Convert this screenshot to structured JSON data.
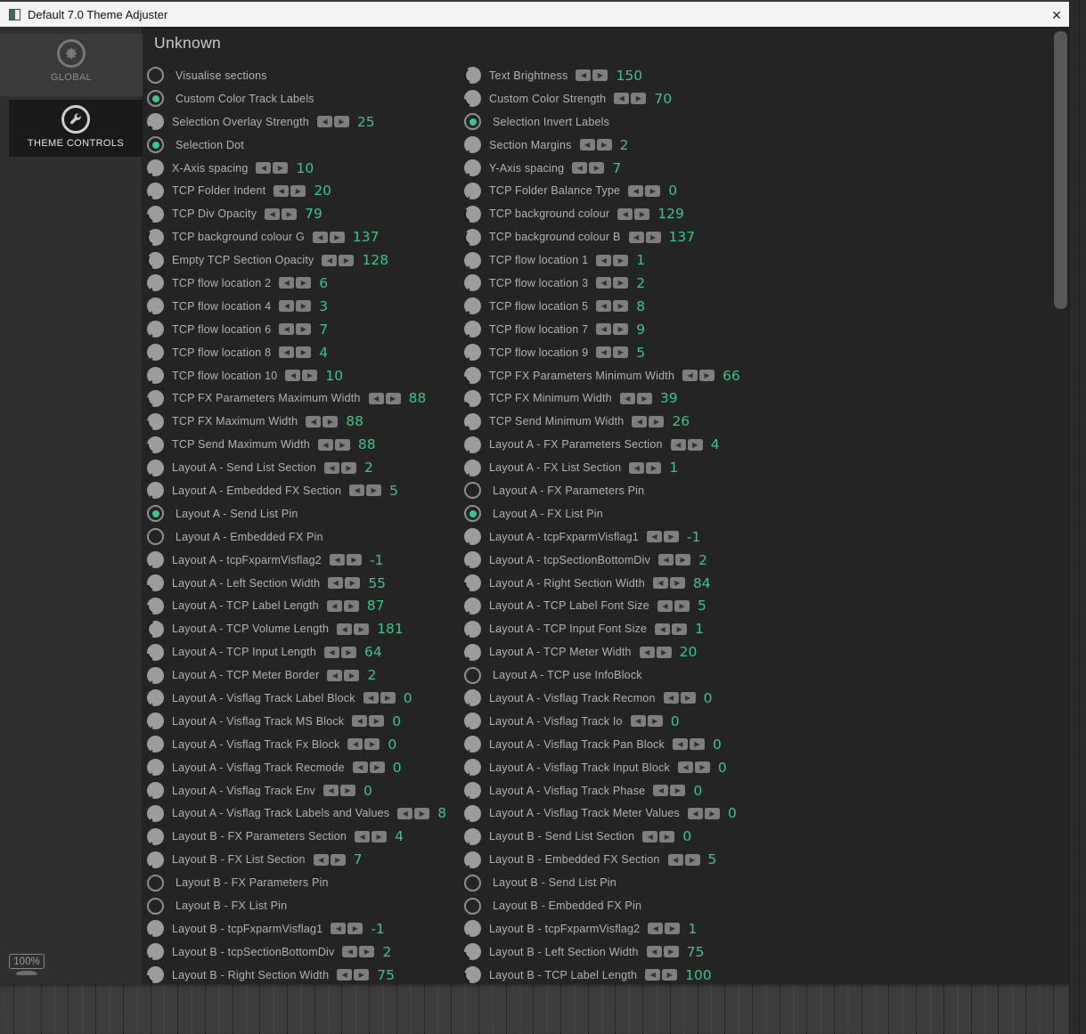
{
  "window": {
    "title": "Default 7.0 Theme Adjuster",
    "close_label": "✕"
  },
  "sidebar": {
    "tabs": [
      {
        "label": "GLOBAL",
        "icon": "gear-icon",
        "active": false
      },
      {
        "label": "THEME CONTROLS",
        "icon": "wrench-icon",
        "active": true
      }
    ],
    "zoom_badge": "100%"
  },
  "content": {
    "heading": "Unknown"
  },
  "icons": {
    "step_down": "◀",
    "step_up": "▶"
  },
  "colors": {
    "accent_green": "#3cc48c",
    "toggle_green": "#2fae78",
    "knob_gray": "#9c9c9c"
  },
  "controls": {
    "left": [
      {
        "label": "Visualise sections",
        "type": "toggle",
        "on": false
      },
      {
        "label": "Custom Color Track Labels",
        "type": "toggle",
        "on": true
      },
      {
        "label": "Selection Overlay Strength",
        "type": "knob",
        "value": "25"
      },
      {
        "label": "Selection Dot",
        "type": "toggle",
        "on": true
      },
      {
        "label": "X-Axis spacing",
        "type": "knob",
        "value": "10"
      },
      {
        "label": "TCP Folder Indent",
        "type": "knob",
        "value": "20"
      },
      {
        "label": "TCP Div Opacity",
        "type": "knob",
        "value": "79"
      },
      {
        "label": "TCP background colour G",
        "type": "knob",
        "value": "137"
      },
      {
        "label": "Empty TCP Section Opacity",
        "type": "knob",
        "value": "128"
      },
      {
        "label": "TCP flow location 2",
        "type": "knob",
        "value": "6"
      },
      {
        "label": "TCP flow location 4",
        "type": "knob",
        "value": "3"
      },
      {
        "label": "TCP flow location 6",
        "type": "knob",
        "value": "7"
      },
      {
        "label": "TCP flow location 8",
        "type": "knob",
        "value": "4"
      },
      {
        "label": "TCP flow location 10",
        "type": "knob",
        "value": "10"
      },
      {
        "label": "TCP FX Parameters Maximum Width",
        "type": "knob",
        "value": "88"
      },
      {
        "label": "TCP FX Maximum Width",
        "type": "knob",
        "value": "88"
      },
      {
        "label": "TCP Send Maximum Width",
        "type": "knob",
        "value": "88"
      },
      {
        "label": "Layout A - Send List Section",
        "type": "knob",
        "value": "2"
      },
      {
        "label": "Layout A - Embedded FX Section",
        "type": "knob",
        "value": "5"
      },
      {
        "label": "Layout A - Send List Pin",
        "type": "toggle",
        "on": true
      },
      {
        "label": "Layout A - Embedded FX Pin",
        "type": "toggle",
        "on": false
      },
      {
        "label": "Layout A - tcpFxparmVisflag2",
        "type": "knob",
        "value": "-1"
      },
      {
        "label": "Layout A - Left Section Width",
        "type": "knob",
        "value": "55"
      },
      {
        "label": "Layout A - TCP Label Length",
        "type": "knob",
        "value": "87"
      },
      {
        "label": "Layout A - TCP Volume Length",
        "type": "knob",
        "value": "181"
      },
      {
        "label": "Layout A - TCP Input Length",
        "type": "knob",
        "value": "64"
      },
      {
        "label": "Layout A - TCP Meter Border",
        "type": "knob",
        "value": "2"
      },
      {
        "label": "Layout A - Visflag Track Label Block",
        "type": "knob",
        "value": "0"
      },
      {
        "label": "Layout A - Visflag Track MS Block",
        "type": "knob",
        "value": "0"
      },
      {
        "label": "Layout A - Visflag Track Fx Block",
        "type": "knob",
        "value": "0"
      },
      {
        "label": "Layout A - Visflag Track Recmode",
        "type": "knob",
        "value": "0"
      },
      {
        "label": "Layout A - Visflag Track Env",
        "type": "knob",
        "value": "0"
      },
      {
        "label": "Layout A - Visflag Track Labels and Values",
        "type": "knob",
        "value": "8"
      },
      {
        "label": "Layout B - FX Parameters Section",
        "type": "knob",
        "value": "4"
      },
      {
        "label": "Layout B - FX List Section",
        "type": "knob",
        "value": "7"
      },
      {
        "label": "Layout B - FX Parameters Pin",
        "type": "toggle",
        "on": false
      },
      {
        "label": "Layout B - FX List Pin",
        "type": "toggle",
        "on": false
      },
      {
        "label": "Layout B - tcpFxparmVisflag1",
        "type": "knob",
        "value": "-1"
      },
      {
        "label": "Layout B - tcpSectionBottomDiv",
        "type": "knob",
        "value": "2"
      },
      {
        "label": "Layout B - Right Section Width",
        "type": "knob",
        "value": "75"
      }
    ],
    "right": [
      {
        "label": "Text Brightness",
        "type": "knob",
        "value": "150"
      },
      {
        "label": "Custom Color Strength",
        "type": "knob",
        "value": "70"
      },
      {
        "label": "Selection Invert Labels",
        "type": "toggle",
        "on": true
      },
      {
        "label": "Section Margins",
        "type": "knob",
        "value": "2"
      },
      {
        "label": "Y-Axis spacing",
        "type": "knob",
        "value": "7"
      },
      {
        "label": "TCP Folder Balance Type",
        "type": "knob",
        "value": "0"
      },
      {
        "label": "TCP background colour",
        "type": "knob",
        "value": "129"
      },
      {
        "label": "TCP background colour B",
        "type": "knob",
        "value": "137"
      },
      {
        "label": "TCP flow location 1",
        "type": "knob",
        "value": "1"
      },
      {
        "label": "TCP flow location 3",
        "type": "knob",
        "value": "2"
      },
      {
        "label": "TCP flow location 5",
        "type": "knob",
        "value": "8"
      },
      {
        "label": "TCP flow location 7",
        "type": "knob",
        "value": "9"
      },
      {
        "label": "TCP flow location 9",
        "type": "knob",
        "value": "5"
      },
      {
        "label": "TCP FX Parameters Minimum Width",
        "type": "knob",
        "value": "66"
      },
      {
        "label": "TCP FX Minimum Width",
        "type": "knob",
        "value": "39"
      },
      {
        "label": "TCP Send Minimum Width",
        "type": "knob",
        "value": "26"
      },
      {
        "label": "Layout A - FX Parameters Section",
        "type": "knob",
        "value": "4"
      },
      {
        "label": "Layout A - FX List Section",
        "type": "knob",
        "value": "1"
      },
      {
        "label": "Layout A - FX Parameters Pin",
        "type": "toggle",
        "on": false
      },
      {
        "label": "Layout A - FX List Pin",
        "type": "toggle",
        "on": true
      },
      {
        "label": "Layout A - tcpFxparmVisflag1",
        "type": "knob",
        "value": "-1"
      },
      {
        "label": "Layout A - tcpSectionBottomDiv",
        "type": "knob",
        "value": "2"
      },
      {
        "label": "Layout A - Right Section Width",
        "type": "knob",
        "value": "84"
      },
      {
        "label": "Layout A - TCP Label Font Size",
        "type": "knob",
        "value": "5"
      },
      {
        "label": "Layout A - TCP Input Font Size",
        "type": "knob",
        "value": "1"
      },
      {
        "label": "Layout A - TCP Meter Width",
        "type": "knob",
        "value": "20"
      },
      {
        "label": "Layout A - TCP use InfoBlock",
        "type": "toggle",
        "on": false
      },
      {
        "label": "Layout A - Visflag Track Recmon",
        "type": "knob",
        "value": "0"
      },
      {
        "label": "Layout A - Visflag Track Io",
        "type": "knob",
        "value": "0"
      },
      {
        "label": "Layout A - Visflag Track Pan Block",
        "type": "knob",
        "value": "0"
      },
      {
        "label": "Layout A - Visflag Track Input Block",
        "type": "knob",
        "value": "0"
      },
      {
        "label": "Layout A - Visflag Track Phase",
        "type": "knob",
        "value": "0"
      },
      {
        "label": "Layout A - Visflag Track Meter Values",
        "type": "knob",
        "value": "0"
      },
      {
        "label": "Layout B - Send List Section",
        "type": "knob",
        "value": "0"
      },
      {
        "label": "Layout B - Embedded FX Section",
        "type": "knob",
        "value": "5"
      },
      {
        "label": "Layout B - Send List Pin",
        "type": "toggle",
        "on": false
      },
      {
        "label": "Layout B - Embedded FX Pin",
        "type": "toggle",
        "on": false
      },
      {
        "label": "Layout B - tcpFxparmVisflag2",
        "type": "knob",
        "value": "1"
      },
      {
        "label": "Layout B - Left Section Width",
        "type": "knob",
        "value": "75"
      },
      {
        "label": "Layout B - TCP Label Length",
        "type": "knob",
        "value": "100"
      }
    ]
  }
}
